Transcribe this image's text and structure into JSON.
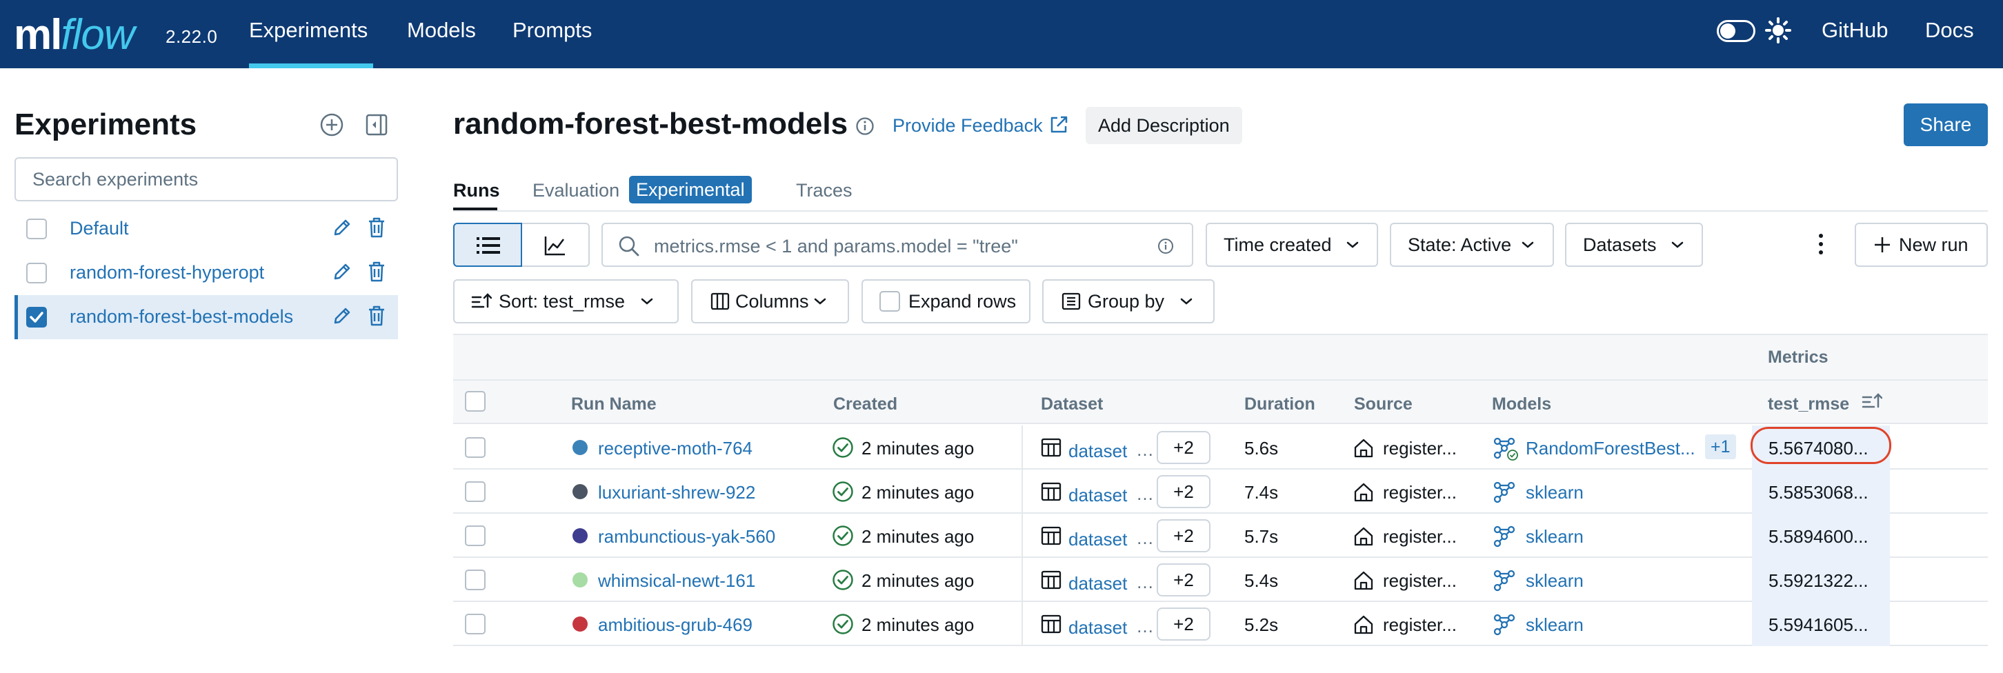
{
  "nav": {
    "logo_ml": "ml",
    "logo_flow": "flow",
    "version": "2.22.0",
    "links": [
      "Experiments",
      "Models",
      "Prompts"
    ],
    "right_links": [
      "GitHub",
      "Docs"
    ],
    "accent_color": "#43c9ed",
    "bg_color": "#0e3a73"
  },
  "sidebar": {
    "title": "Experiments",
    "search_placeholder": "Search experiments",
    "experiments": [
      {
        "name": "Default",
        "checked": false
      },
      {
        "name": "random-forest-hyperopt",
        "checked": false
      },
      {
        "name": "random-forest-best-models",
        "checked": true
      }
    ]
  },
  "header": {
    "title": "random-forest-best-models",
    "feedback": "Provide Feedback",
    "add_description": "Add Description",
    "share": "Share"
  },
  "tabs": {
    "runs": "Runs",
    "evaluation": "Evaluation",
    "experimental_badge": "Experimental",
    "traces": "Traces"
  },
  "toolbar": {
    "search_value": "metrics.rmse < 1 and params.model = \"tree\"",
    "time_created": "Time created",
    "state": "State: Active",
    "datasets": "Datasets",
    "new_run": "New run",
    "sort": "Sort: test_rmse",
    "columns": "Columns",
    "expand_rows": "Expand rows",
    "group_by": "Group by"
  },
  "table": {
    "group_header_metrics": "Metrics",
    "columns": [
      "Run Name",
      "Created",
      "Dataset",
      "Duration",
      "Source",
      "Models",
      "test_rmse"
    ],
    "rows": [
      {
        "run_name": "receptive-moth-764",
        "color": "#3b82b8",
        "created": "2 minutes ago",
        "dataset": "dataset",
        "dataset_more": "+2",
        "duration": "5.6s",
        "source": "register...",
        "model": "RandomForestBest...",
        "model_more": "+1",
        "test_rmse": "5.5674080..."
      },
      {
        "run_name": "luxuriant-shrew-922",
        "color": "#4b5563",
        "created": "2 minutes ago",
        "dataset": "dataset",
        "dataset_more": "+2",
        "duration": "7.4s",
        "source": "register...",
        "model": "sklearn",
        "model_more": "",
        "test_rmse": "5.5853068..."
      },
      {
        "run_name": "rambunctious-yak-560",
        "color": "#3f3d8f",
        "created": "2 minutes ago",
        "dataset": "dataset",
        "dataset_more": "+2",
        "duration": "5.7s",
        "source": "register...",
        "model": "sklearn",
        "model_more": "",
        "test_rmse": "5.5894600..."
      },
      {
        "run_name": "whimsical-newt-161",
        "color": "#a7dca5",
        "created": "2 minutes ago",
        "dataset": "dataset",
        "dataset_more": "+2",
        "duration": "5.4s",
        "source": "register...",
        "model": "sklearn",
        "model_more": "",
        "test_rmse": "5.5921322..."
      },
      {
        "run_name": "ambitious-grub-469",
        "color": "#c6363e",
        "created": "2 minutes ago",
        "dataset": "dataset",
        "dataset_more": "+2",
        "duration": "5.2s",
        "source": "register...",
        "model": "sklearn",
        "model_more": "",
        "test_rmse": "5.5941605..."
      }
    ]
  }
}
